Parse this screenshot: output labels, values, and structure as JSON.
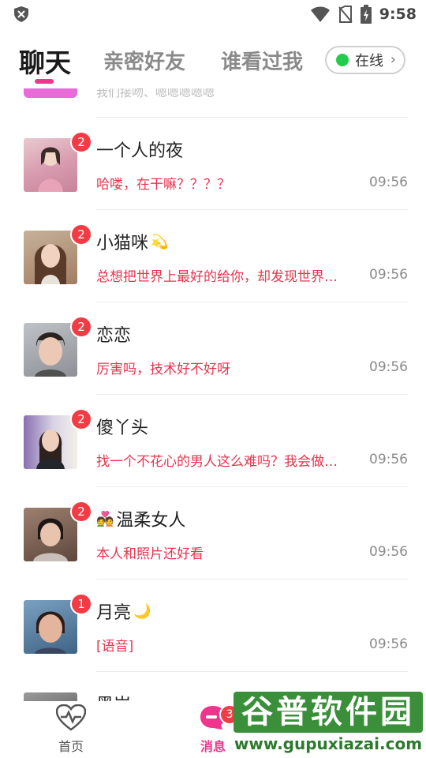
{
  "status_bar": {
    "time": "9:58",
    "icons": [
      "shield-icon",
      "wifi-icon",
      "no-sim-icon",
      "battery-charging-icon"
    ]
  },
  "tabs": {
    "items": [
      {
        "label": "聊天",
        "active": true
      },
      {
        "label": "亲密好友",
        "active": false
      },
      {
        "label": "谁看过我",
        "active": false
      }
    ],
    "online_toggle": {
      "label": "在线",
      "status_color": "#22cc4a"
    }
  },
  "chat_list": {
    "partial_top_text": "我们接吻、嗯嗯嗯嗯嗯",
    "items": [
      {
        "name": "一个人的夜",
        "emoji": "",
        "unread": "2",
        "message": "哈喽，在干嘛？？？？",
        "time": "09:56",
        "avatar_color": "#d9a2b0"
      },
      {
        "name": "小猫咪",
        "emoji": "💫",
        "unread": "2",
        "message": "总想把世界上最好的给你，却发现世界…",
        "time": "09:56",
        "avatar_color": "#b48a6c"
      },
      {
        "name": "恋恋",
        "emoji": "",
        "unread": "2",
        "message": "厉害吗，技术好不好呀",
        "time": "09:56",
        "avatar_color": "#6f6f6f"
      },
      {
        "name": "傻丫头",
        "emoji": "",
        "unread": "2",
        "message": "找一个不花心的男人这么难吗？我会做…",
        "time": "09:56",
        "avatar_color": "#8a6fa8"
      },
      {
        "name": "温柔女人",
        "emoji": "💑",
        "unread": "2",
        "message": "本人和照片还好看",
        "time": "09:56",
        "avatar_color": "#7a5a4a"
      },
      {
        "name": "月亮",
        "emoji": "🌙",
        "unread": "1",
        "message": "[语音]",
        "time": "09:56",
        "avatar_color": "#5a7ea0"
      },
      {
        "name": "黑岩",
        "emoji": "",
        "unread": "",
        "message": "",
        "time": "",
        "avatar_color": "#444444"
      }
    ]
  },
  "bottom_nav": {
    "home_label": "首页",
    "messages_label": "消息",
    "messages_badge": "3"
  },
  "watermark": {
    "title": "谷普软件园",
    "url": "www.gupuxiazai.com"
  }
}
